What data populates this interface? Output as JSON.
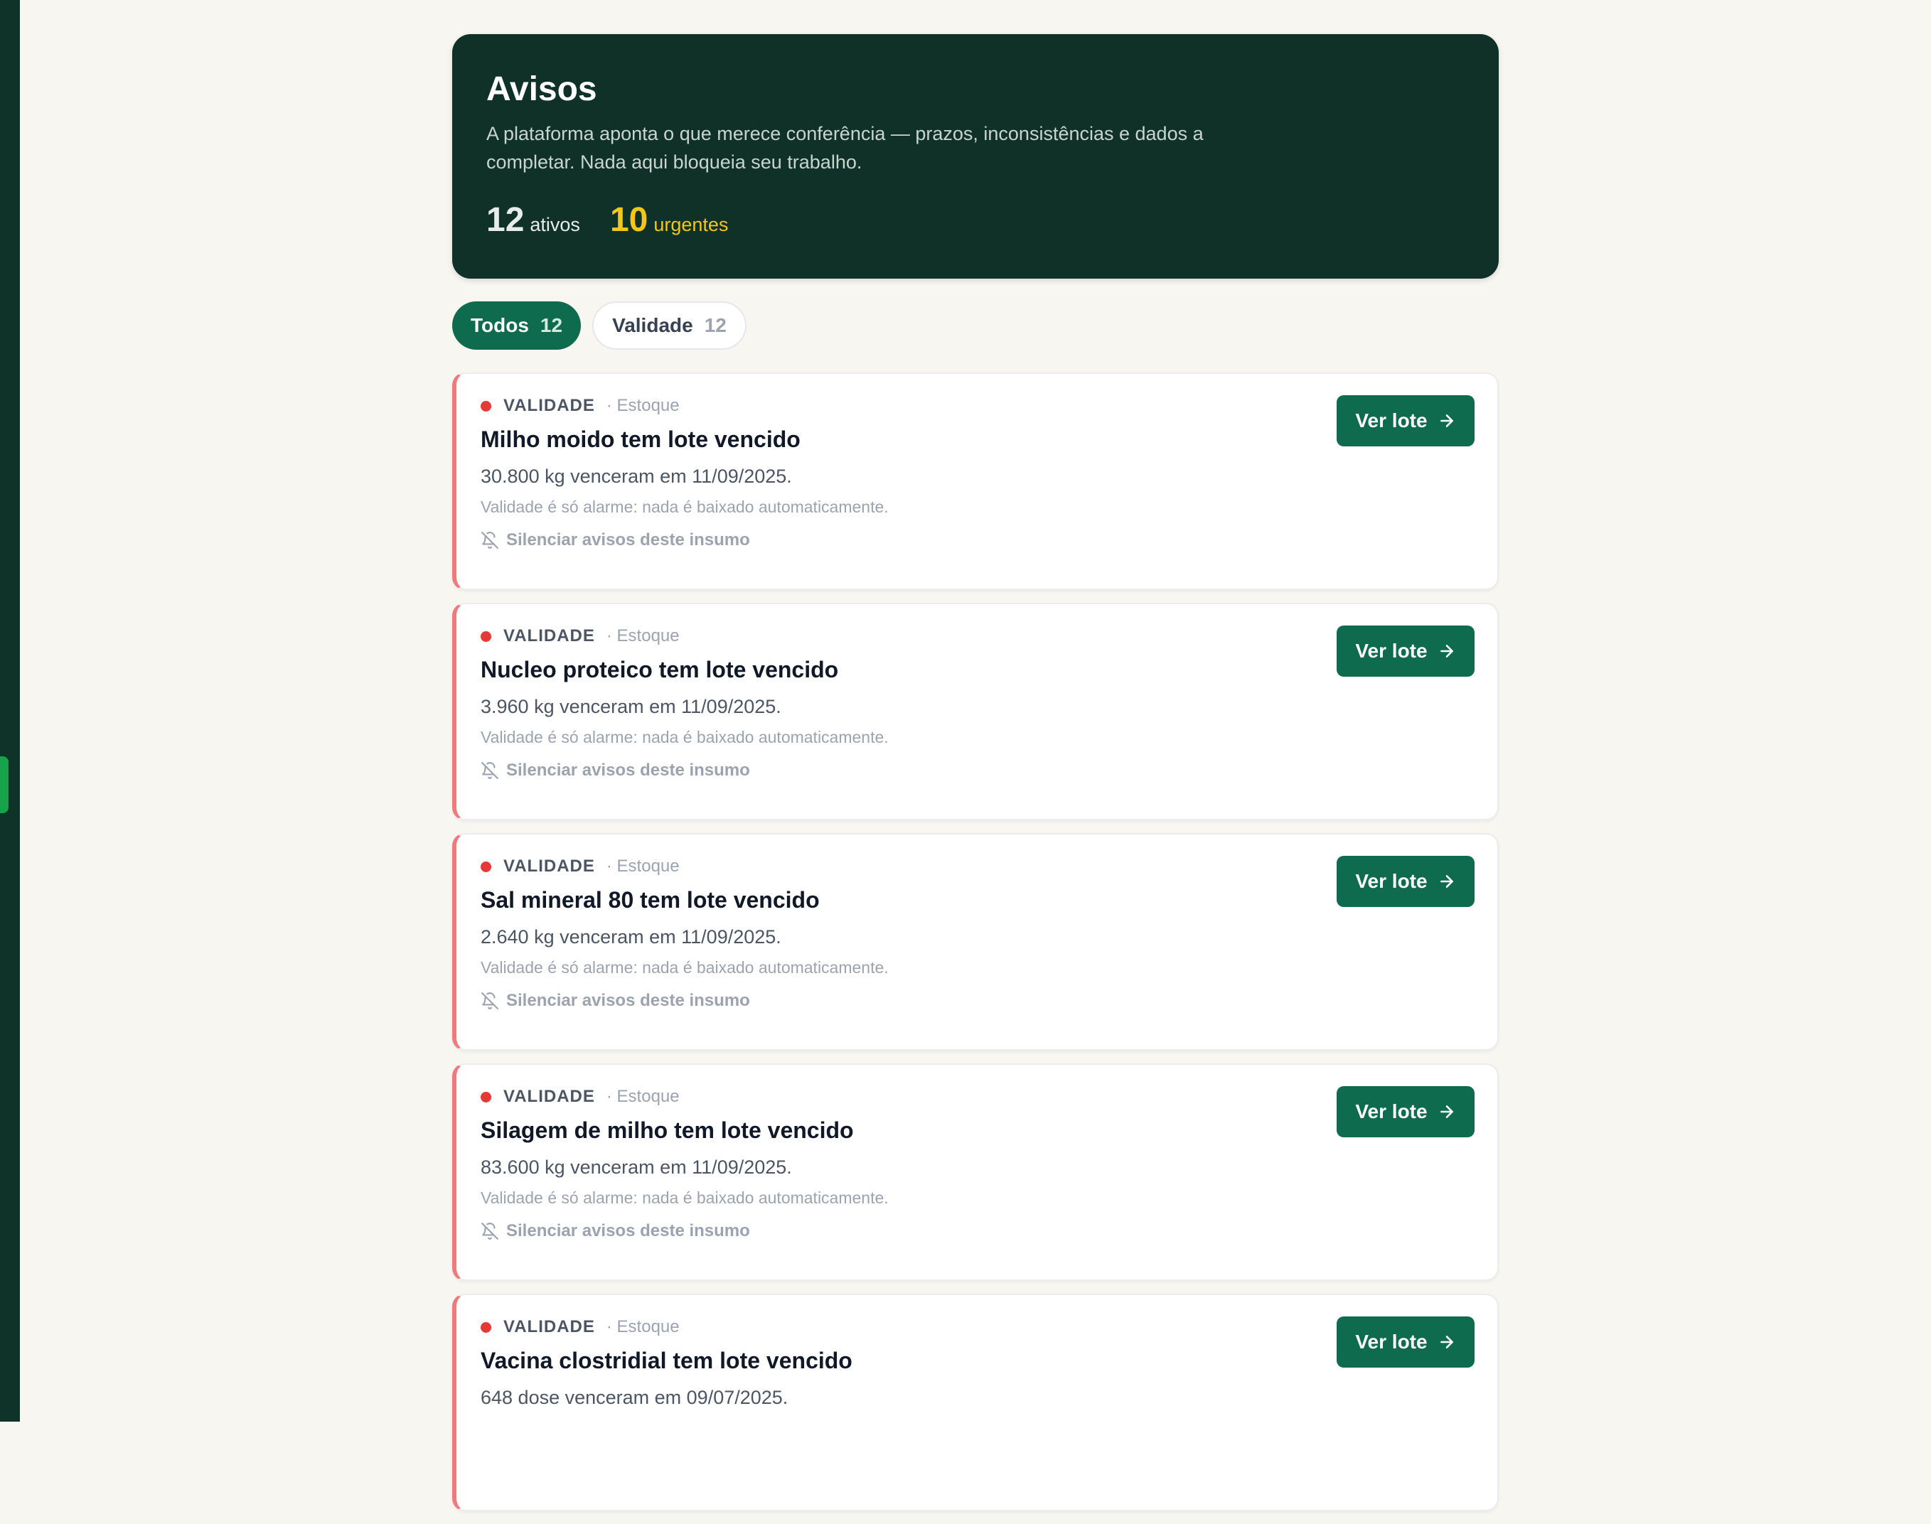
{
  "header": {
    "title": "Avisos",
    "description": "A plataforma aponta o que merece conferência — prazos, inconsistências e dados a completar. Nada aqui bloqueia seu trabalho.",
    "active_count": "12",
    "active_label": "ativos",
    "urgent_count": "10",
    "urgent_label": "urgentes",
    "urgent_color": "#f5c518"
  },
  "tabs": [
    {
      "label": "Todos",
      "count": "12",
      "selected": true
    },
    {
      "label": "Validade",
      "count": "12",
      "selected": false
    }
  ],
  "alerts": [
    {
      "category": "VALIDADE",
      "source": "· Estoque",
      "title": "Milho moido tem lote vencido",
      "description": "30.800 kg venceram em 11/09/2025.",
      "note": "Validade é só alarme: nada é baixado automaticamente.",
      "mute_label": "Silenciar avisos deste insumo",
      "action_label": "Ver lote"
    },
    {
      "category": "VALIDADE",
      "source": "· Estoque",
      "title": "Nucleo proteico tem lote vencido",
      "description": "3.960 kg venceram em 11/09/2025.",
      "note": "Validade é só alarme: nada é baixado automaticamente.",
      "mute_label": "Silenciar avisos deste insumo",
      "action_label": "Ver lote"
    },
    {
      "category": "VALIDADE",
      "source": "· Estoque",
      "title": "Sal mineral 80 tem lote vencido",
      "description": "2.640 kg venceram em 11/09/2025.",
      "note": "Validade é só alarme: nada é baixado automaticamente.",
      "mute_label": "Silenciar avisos deste insumo",
      "action_label": "Ver lote"
    },
    {
      "category": "VALIDADE",
      "source": "· Estoque",
      "title": "Silagem de milho tem lote vencido",
      "description": "83.600 kg venceram em 11/09/2025.",
      "note": "Validade é só alarme: nada é baixado automaticamente.",
      "mute_label": "Silenciar avisos deste insumo",
      "action_label": "Ver lote"
    },
    {
      "category": "VALIDADE",
      "source": "· Estoque",
      "title": "Vacina clostridial tem lote vencido",
      "description": "648 dose venceram em 09/07/2025.",
      "note": "",
      "mute_label": "",
      "action_label": "Ver lote"
    }
  ],
  "colors": {
    "brand": "#0f6b4e",
    "hero_bg": "#0f3128",
    "alert_border": "#f0797b",
    "alert_dot": "#e53935"
  },
  "icons": {
    "mute": "bell-off-icon",
    "action": "arrow-right-icon"
  }
}
